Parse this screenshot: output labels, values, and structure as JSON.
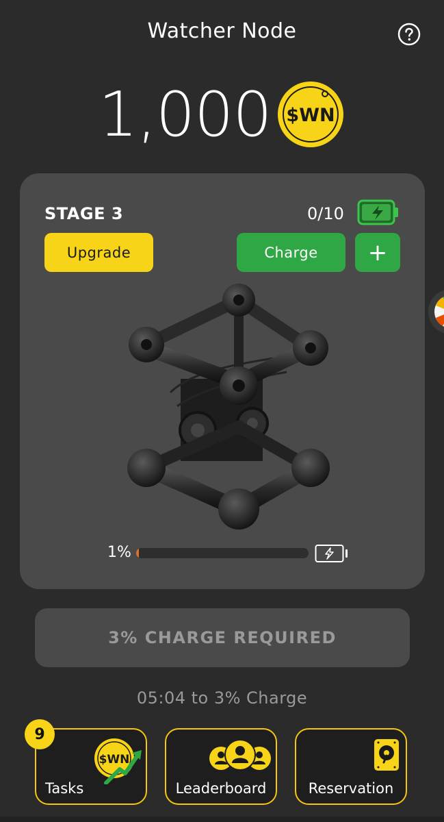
{
  "header": {
    "title": "Watcher Node"
  },
  "balance": {
    "amount": "1,000",
    "coin_label": "$WN"
  },
  "node": {
    "stage_label": "STAGE 3",
    "charge_count": "0/10",
    "upgrade_label": "Upgrade",
    "charge_label": "Charge",
    "plus_label": "+",
    "progress_percent_label": "1%",
    "progress_value": 0.01
  },
  "action": {
    "charge_required_label": "3% CHARGE REQUIRED",
    "countdown_text": "05:04 to 3% Charge"
  },
  "nav": {
    "tasks": {
      "label": "Tasks",
      "badge": "9",
      "coin_label": "$WN"
    },
    "leaderboard": {
      "label": "Leaderboard"
    },
    "reservation": {
      "label": "Reservation"
    }
  },
  "colors": {
    "background": "#2b2b2b",
    "card": "#4a4a4a",
    "accent_yellow": "#f7d417",
    "accent_green": "#2fa745",
    "progress_fill": "#d9732b",
    "muted_text": "#9a9a9a"
  },
  "icons": {
    "help": "question-circle-icon",
    "coin": "swn-coin-icon",
    "battery_full": "battery-charging-icon",
    "battery_empty": "battery-empty-icon",
    "tasks": "swn-coin-growth-icon",
    "leaderboard": "users-group-icon",
    "reservation": "hard-drive-icon"
  }
}
